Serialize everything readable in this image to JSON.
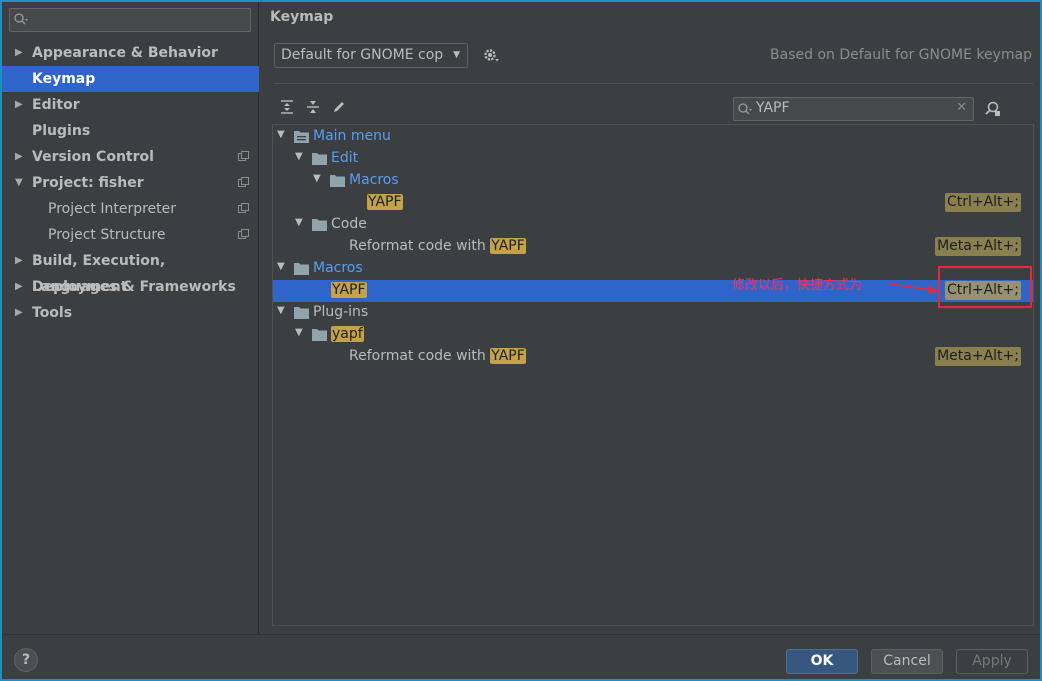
{
  "sidebar": {
    "search_placeholder": "",
    "items": [
      {
        "label": "Appearance & Behavior",
        "arrow": "▶"
      },
      {
        "label": "Keymap",
        "arrow": ""
      },
      {
        "label": "Editor",
        "arrow": "▶"
      },
      {
        "label": "Plugins",
        "arrow": ""
      },
      {
        "label": "Version Control",
        "arrow": "▶"
      },
      {
        "label": "Project: fisher",
        "arrow": "▼"
      },
      {
        "label": "Project Interpreter",
        "arrow": ""
      },
      {
        "label": "Project Structure",
        "arrow": ""
      },
      {
        "label": "Build, Execution, Deployment",
        "arrow": "▶"
      },
      {
        "label": "Languages & Frameworks",
        "arrow": "▶"
      },
      {
        "label": "Tools",
        "arrow": "▶"
      }
    ]
  },
  "main": {
    "title": "Keymap",
    "keymap_select": "Default for GNOME cop",
    "based_on": "Based on Default for GNOME keymap",
    "filter_value": "YAPF",
    "clear_glyph": "✕"
  },
  "tree": {
    "expanded": "▼",
    "rows": {
      "main_menu": "Main menu",
      "edit": "Edit",
      "macros_sub": "Macros",
      "yapf_1": "YAPF",
      "yapf_1_shortcut": "Ctrl+Alt+;",
      "code": "Code",
      "reformat_prefix": "Reformat code with ",
      "reformat_highlight": "YAPF",
      "reformat_shortcut": "Meta+Alt+;",
      "macros": "Macros",
      "yapf_2": "YAPF",
      "yapf_2_shortcut": "Ctrl+Alt+;",
      "plugins": "Plug-ins",
      "yapf_plugin": "yapf",
      "reformat2_prefix": "Reformat code with ",
      "reformat2_highlight": "YAPF",
      "reformat2_shortcut": "Meta+Alt+;"
    }
  },
  "annotation": {
    "text": "修改以后，快捷方式为",
    "color": "#e8283a"
  },
  "buttons": {
    "help": "?",
    "ok": "OK",
    "cancel": "Cancel",
    "apply": "Apply"
  },
  "colors": {
    "accent": "#2f65ca",
    "link": "#589df6",
    "highlight": "#c3a24a"
  }
}
